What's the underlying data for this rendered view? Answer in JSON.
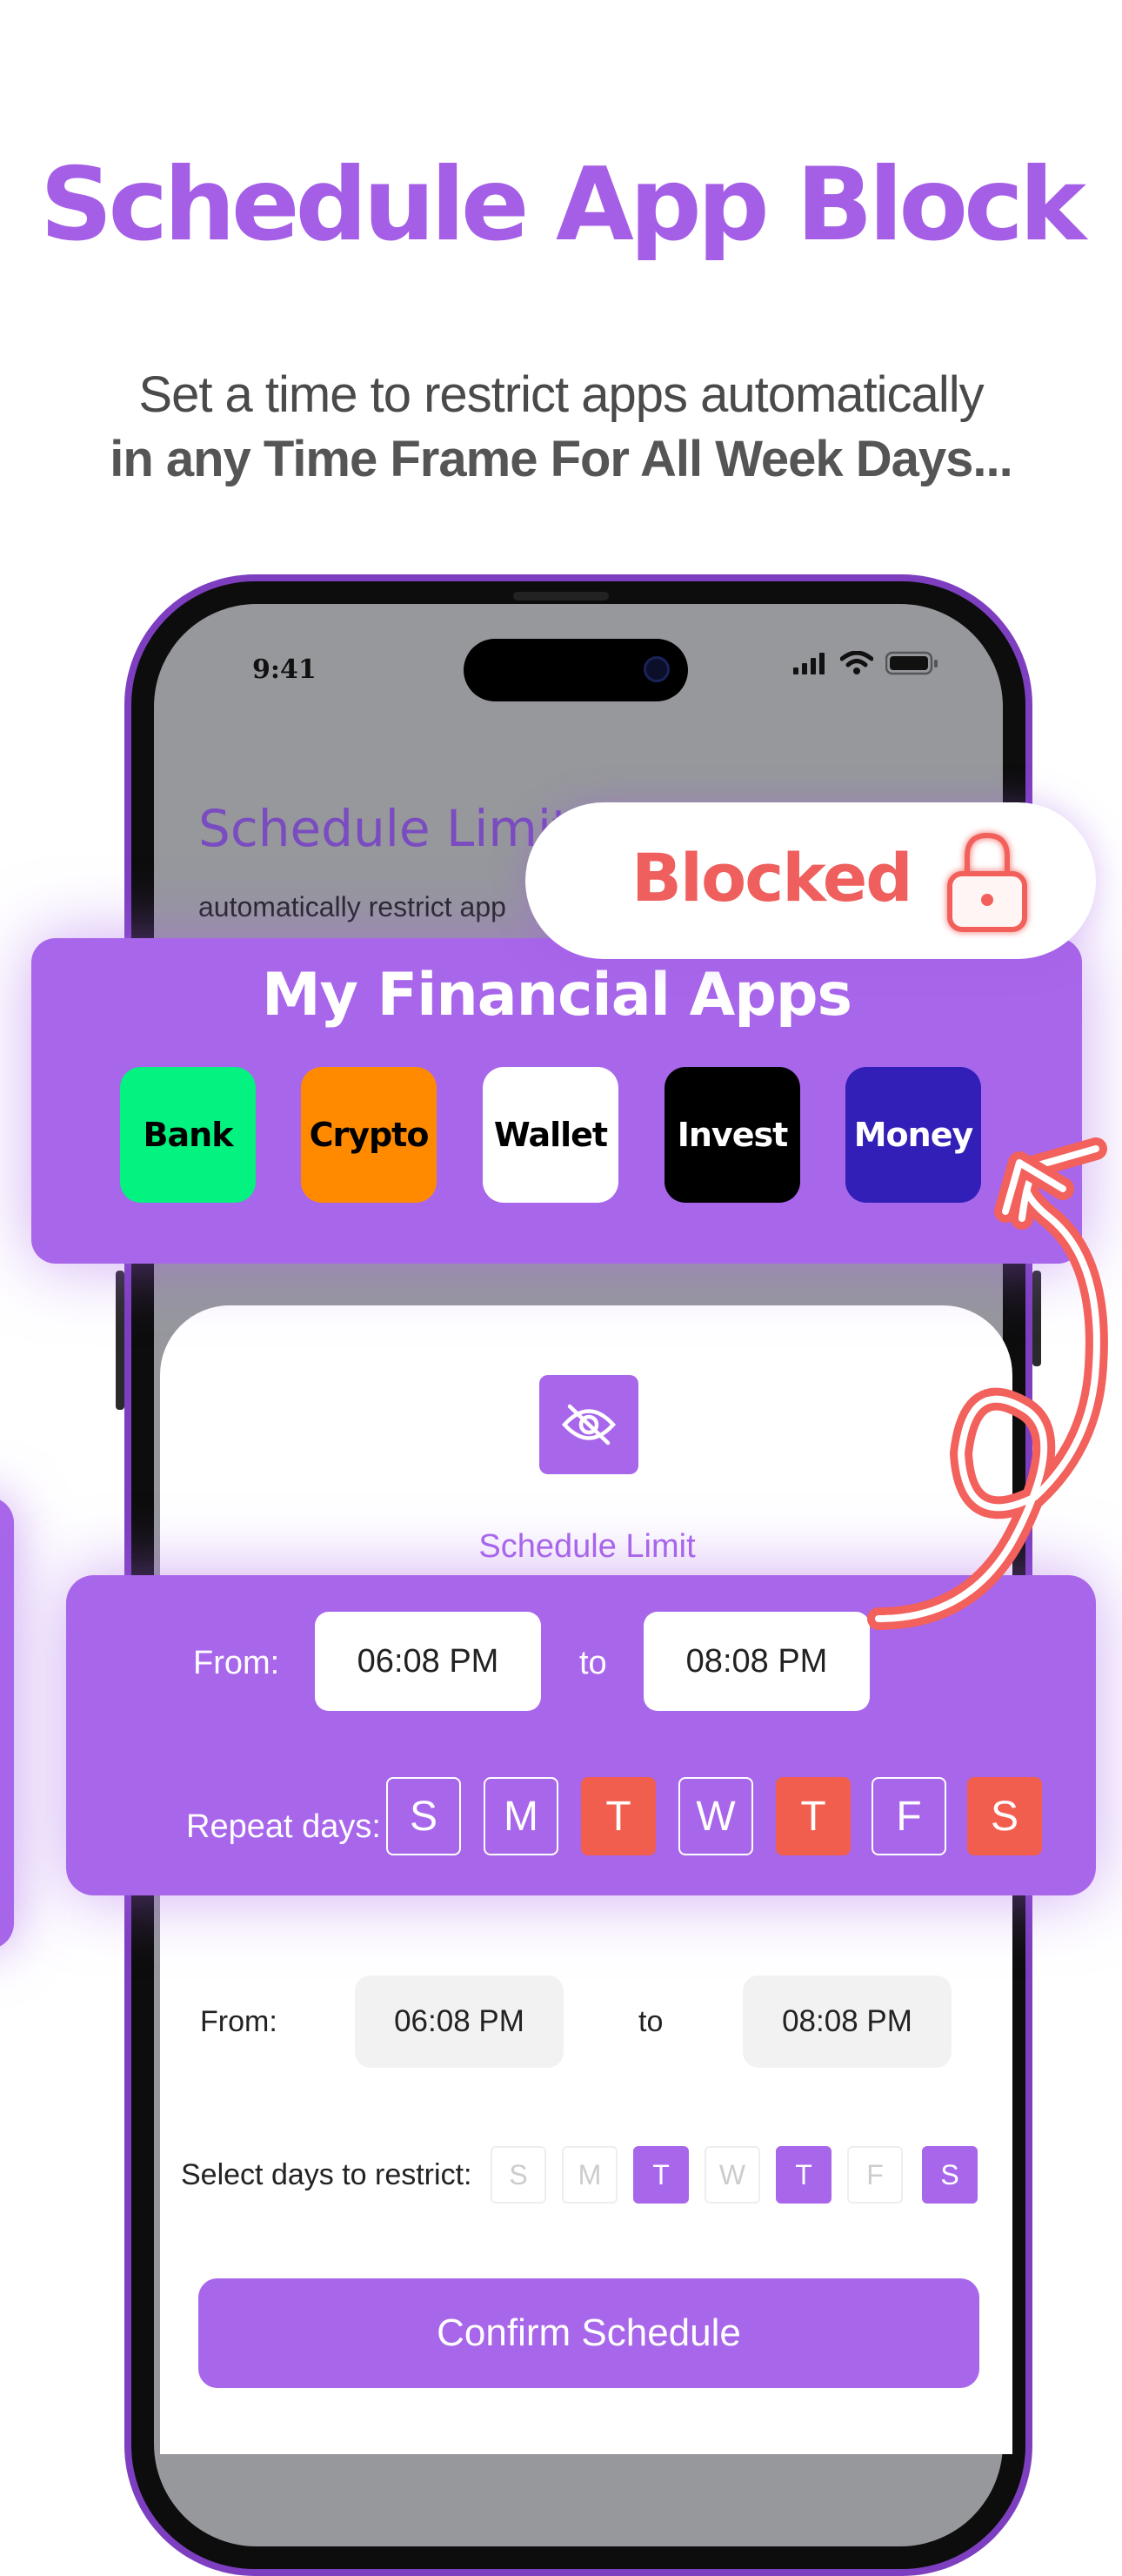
{
  "headline": "Schedule App Block",
  "subtitle": {
    "line1": "Set a time to restrict apps automatically",
    "line2": "in any Time Frame For All Week Days..."
  },
  "status_bar": {
    "time": "9:41",
    "icons": [
      "signal-icon",
      "wifi-icon",
      "battery-icon"
    ]
  },
  "background_screen": {
    "title": "Schedule Limit",
    "text": "automatically restrict app"
  },
  "blocked_badge": {
    "label": "Blocked",
    "icon": "lock-icon"
  },
  "apps_card": {
    "title": "My Financial Apps",
    "apps": [
      {
        "label": "Bank",
        "bg": "#04f27f",
        "fg": "#000000"
      },
      {
        "label": "Crypto",
        "bg": "#ff8a00",
        "fg": "#000000"
      },
      {
        "label": "Wallet",
        "bg": "#ffffff",
        "fg": "#000000"
      },
      {
        "label": "Invest",
        "bg": "#000000",
        "fg": "#ffffff"
      },
      {
        "label": "Money",
        "bg": "#321fb8",
        "fg": "#ffffff"
      }
    ]
  },
  "sheet": {
    "icon": "eye-off-icon",
    "label": "Schedule Limit"
  },
  "time_card": {
    "from_label": "From:",
    "from_time": "06:08 PM",
    "to_label": "to",
    "to_time": "08:08 PM",
    "repeat_label": "Repeat days:",
    "days": [
      {
        "label": "S",
        "selected": false
      },
      {
        "label": "M",
        "selected": false
      },
      {
        "label": "T",
        "selected": true
      },
      {
        "label": "W",
        "selected": false
      },
      {
        "label": "T",
        "selected": true
      },
      {
        "label": "F",
        "selected": false
      },
      {
        "label": "S",
        "selected": true
      }
    ]
  },
  "lower_form": {
    "from_label": "From:",
    "from_time": "06:08 PM",
    "to_label": "to",
    "to_time": "08:08 PM",
    "select_label": "Select days to restrict:",
    "days": [
      {
        "label": "S",
        "selected": false
      },
      {
        "label": "M",
        "selected": false
      },
      {
        "label": "T",
        "selected": true
      },
      {
        "label": "W",
        "selected": false
      },
      {
        "label": "T",
        "selected": true
      },
      {
        "label": "F",
        "selected": false
      },
      {
        "label": "S",
        "selected": true
      }
    ],
    "confirm_label": "Confirm Schedule"
  },
  "colors": {
    "accent": "#a866ea",
    "headline": "#a55fe6",
    "blocked": "#ee5f5d",
    "selected_day": "#f25e4e"
  }
}
